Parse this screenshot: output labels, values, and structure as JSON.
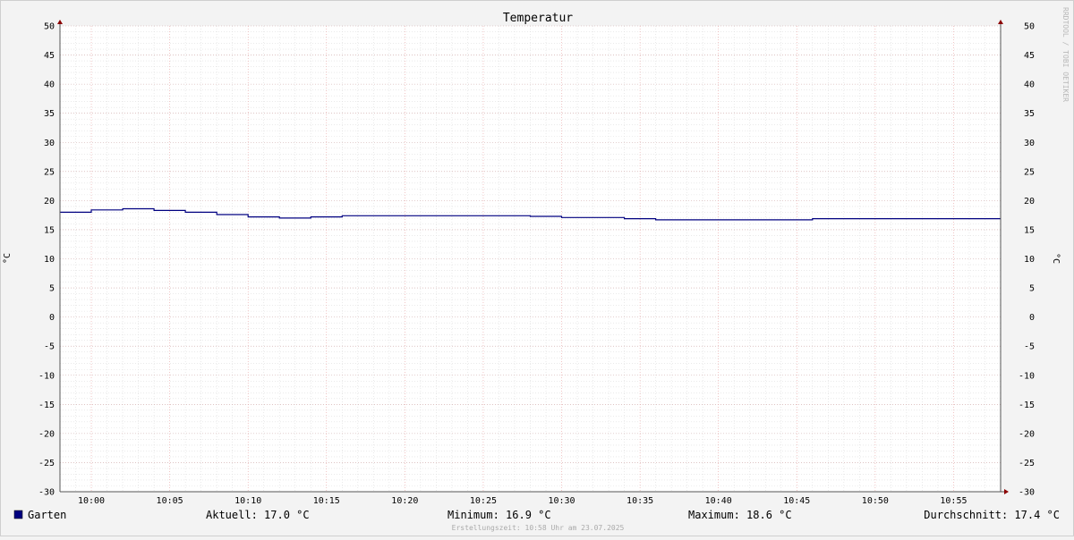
{
  "chart_data": {
    "type": "line",
    "title": "Temperatur",
    "ylabel_left": "°C",
    "ylabel_right": "°C",
    "ylim": [
      -30,
      50
    ],
    "y_ticks": [
      -30,
      -25,
      -20,
      -15,
      -10,
      -5,
      0,
      5,
      10,
      15,
      20,
      25,
      30,
      35,
      40,
      45,
      50
    ],
    "x_range": [
      "09:58",
      "10:58"
    ],
    "x_ticks": [
      "10:00",
      "10:05",
      "10:10",
      "10:15",
      "10:20",
      "10:25",
      "10:30",
      "10:35",
      "10:40",
      "10:45",
      "10:50",
      "10:55"
    ],
    "grid": true,
    "series": [
      {
        "name": "Garten",
        "color": "#000080",
        "step": true,
        "x": [
          "09:58",
          "10:00",
          "10:02",
          "10:04",
          "10:06",
          "10:08",
          "10:10",
          "10:12",
          "10:14",
          "10:16",
          "10:28",
          "10:30",
          "10:34",
          "10:36",
          "10:46",
          "10:58"
        ],
        "values": [
          18.0,
          18.4,
          18.6,
          18.3,
          18.0,
          17.6,
          17.2,
          17.0,
          17.2,
          17.4,
          17.3,
          17.1,
          16.9,
          16.7,
          16.9,
          16.9
        ]
      }
    ]
  },
  "legend": {
    "series_name": "Garten",
    "swatch_color": "#000080",
    "current": "Aktuell: 17.0 °C",
    "minimum": "Minimum: 16.9 °C",
    "maximum": "Maximum: 18.6 °C",
    "average": "Durchschnitt: 17.4 °C"
  },
  "footer": {
    "created": "Erstellungszeit: 10:58 Uhr am 23.07.2025"
  },
  "watermark": "RRDTOOL / TOBI OETIKER"
}
